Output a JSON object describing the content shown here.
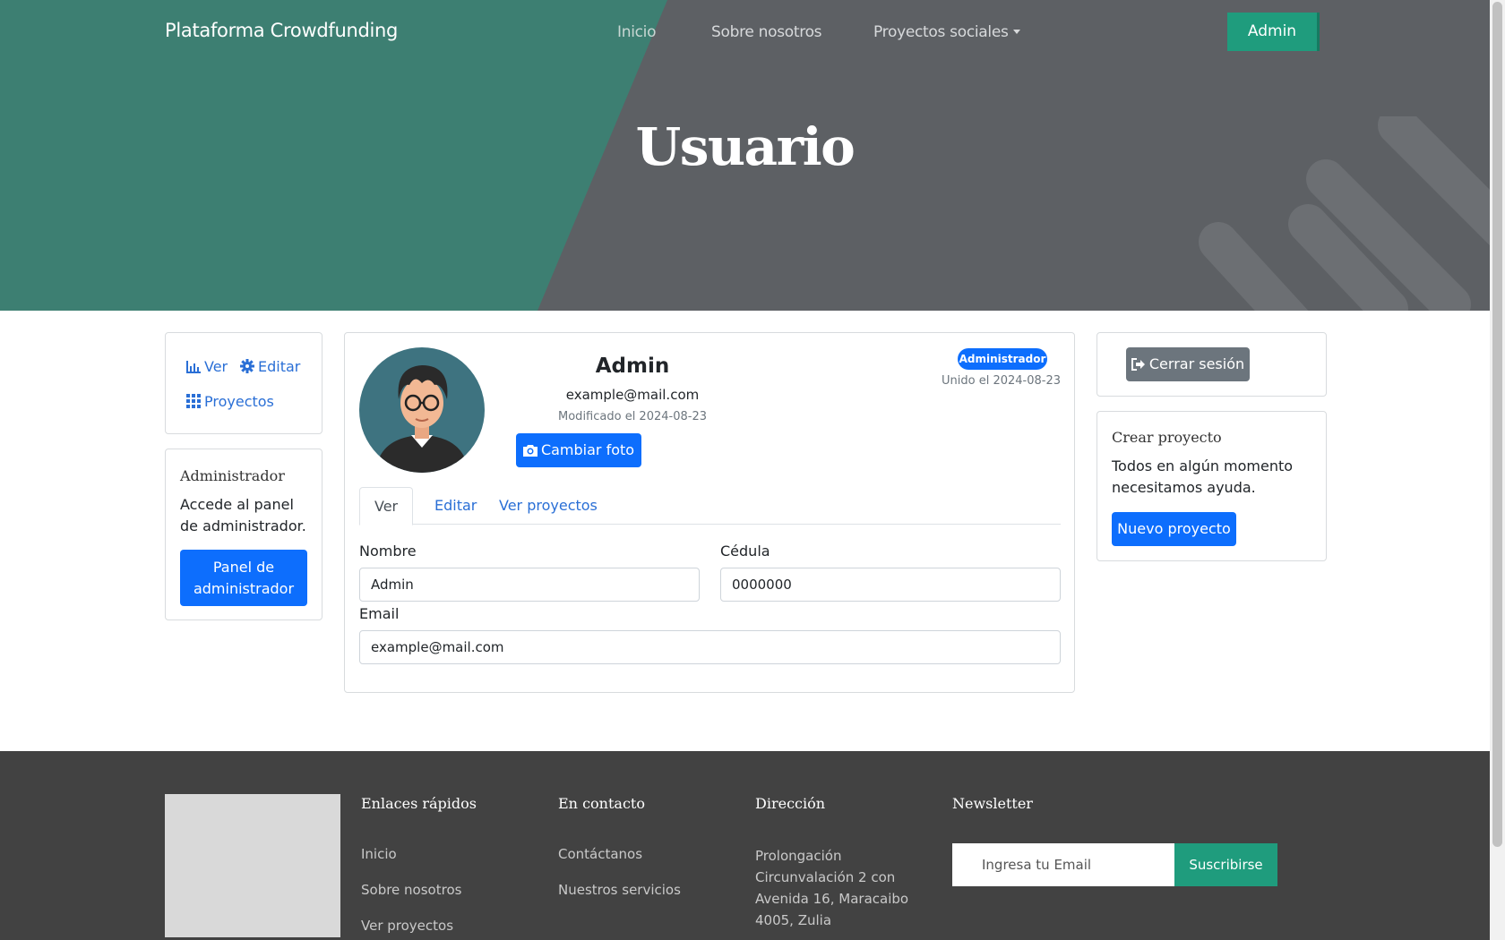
{
  "navbar": {
    "brand": "Plataforma Crowdfunding",
    "links": [
      "Inicio",
      "Sobre nosotros",
      "Proyectos sociales"
    ],
    "admin_button": "Admin"
  },
  "hero": {
    "title": "Usuario"
  },
  "left_nav": {
    "ver": "Ver",
    "editar": "Editar",
    "proyectos": "Proyectos"
  },
  "admin_card": {
    "title": "Administrador",
    "text": "Accede al panel de administrador.",
    "button": "Panel de administrador"
  },
  "profile": {
    "name": "Admin",
    "email": "example@mail.com",
    "modified": "Modificado el 2024-08-23",
    "change_photo": "Cambiar foto",
    "badge": "Administrador",
    "joined": "Unido el 2024-08-23",
    "tabs": [
      "Ver",
      "Editar",
      "Ver proyectos"
    ],
    "fields": {
      "nombre_label": "Nombre",
      "nombre_value": "Admin",
      "cedula_label": "Cédula",
      "cedula_value": "0000000",
      "email_label": "Email",
      "email_value": "example@mail.com"
    }
  },
  "logout": {
    "button": "Cerrar sesión"
  },
  "crear_card": {
    "title": "Crear proyecto",
    "text": "Todos en algún momento necesitamos ayuda.",
    "button": "Nuevo proyecto"
  },
  "footer": {
    "quick_links_title": "Enlaces rápidos",
    "quick_links": [
      "Inicio",
      "Sobre nosotros",
      "Ver proyectos"
    ],
    "contact_title": "En contacto",
    "contact_links": [
      "Contáctanos",
      "Nuestros servicios"
    ],
    "address_title": "Dirección",
    "address": "Prolongación Circunvalación 2 con Avenida 16, Maracaibo 4005, Zulia",
    "newsletter_title": "Newsletter",
    "newsletter_placeholder": "Ingresa tu Email",
    "newsletter_button": "Suscribirse"
  },
  "colors": {
    "hero_green": "#3d7f72",
    "hero_gray": "#5d6064",
    "accent_green": "#1f9c7d",
    "primary_blue": "#0d6efd",
    "footer_bg": "#424242"
  },
  "icons": [
    "bar-chart-icon",
    "gear-icon",
    "grid-icon",
    "camera-icon",
    "sign-out-icon",
    "caret-down-icon"
  ]
}
